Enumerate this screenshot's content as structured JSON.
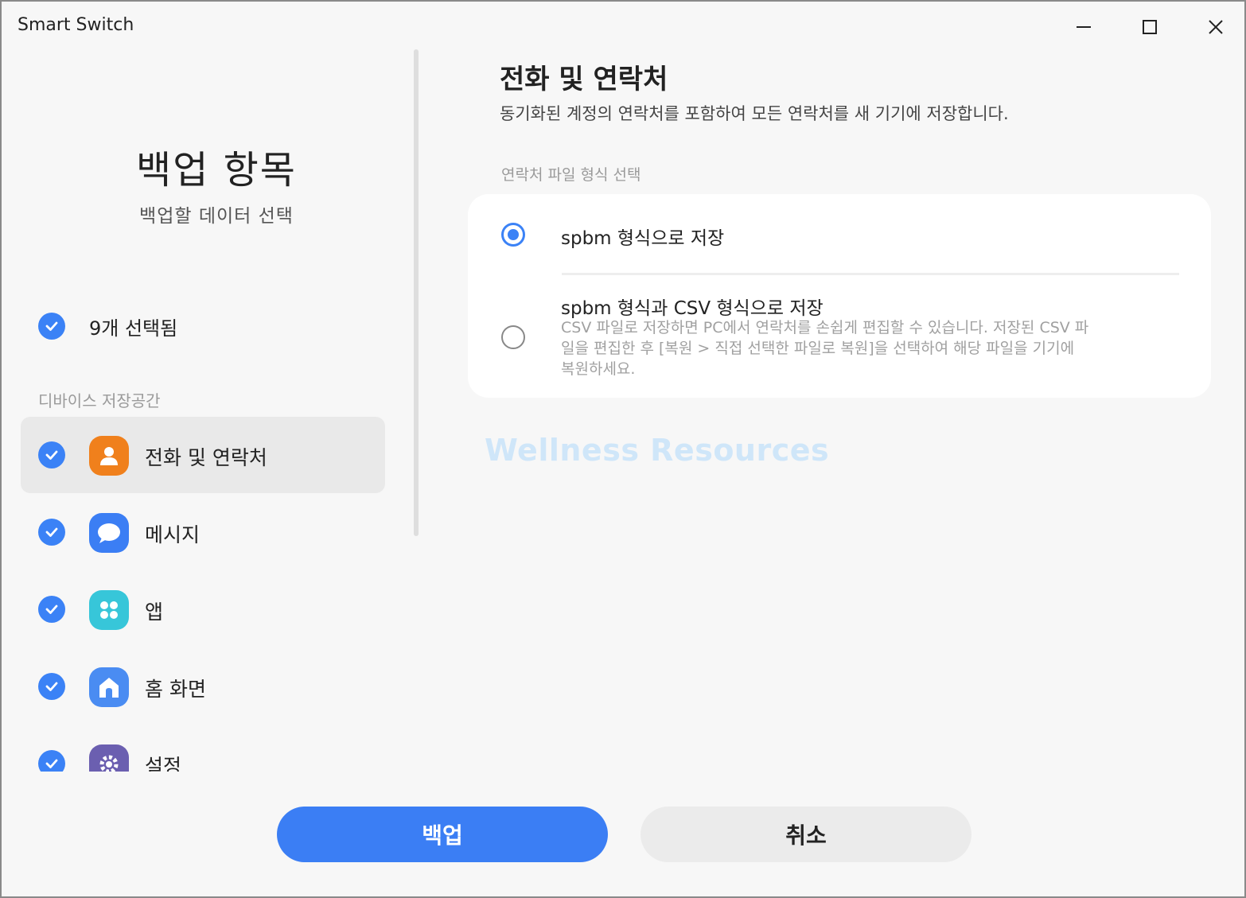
{
  "window": {
    "title": "Smart Switch",
    "controls": [
      "minimize-icon",
      "maximize-icon",
      "close-icon"
    ]
  },
  "sidebar": {
    "title": "백업 항목",
    "subtitle": "백업할 데이터 선택",
    "selected_count": "9개 선택됨",
    "section_label": "디바이스 저장공간",
    "items": [
      {
        "label": "전화 및 연락처",
        "icon": "contacts-icon",
        "color": "#f0801c",
        "checked": true,
        "active": true
      },
      {
        "label": "메시지",
        "icon": "message-icon",
        "color": "#3b7ef4",
        "checked": true,
        "active": false
      },
      {
        "label": "앱",
        "icon": "apps-icon",
        "color": "#37c6d9",
        "checked": true,
        "active": false
      },
      {
        "label": "홈 화면",
        "icon": "home-icon",
        "color": "#4a8cf2",
        "checked": true,
        "active": false
      },
      {
        "label": "설정",
        "icon": "settings-icon",
        "color": "#6b5fb0",
        "checked": true,
        "active": false
      }
    ]
  },
  "detail": {
    "title": "전화 및 연락처",
    "description": "동기화된 계정의 연락처를 포함하여 모든 연락처를 새 기기에 저장합니다.",
    "format_label": "연락처 파일 형식 선택",
    "options": [
      {
        "label": "spbm 형식으로 저장",
        "selected": true
      },
      {
        "label": "spbm 형식과 CSV 형식으로 저장",
        "selected": false,
        "description_lines": [
          "CSV 파일로 저장하면 PC에서 연락처를 손쉽게 편집할 수 있습니다. 저장된 CSV 파",
          "일을 편집한 후 [복원 > 직접 선택한 파일로 복원]을 선택하여 해당 파일을 기기에",
          "복원하세요."
        ]
      }
    ]
  },
  "watermark": "Wellness Resources",
  "buttons": {
    "backup": "백업",
    "cancel": "취소"
  },
  "colors": {
    "accent": "#3b7ef4",
    "background": "#f7f7f7",
    "card": "#ffffff"
  }
}
